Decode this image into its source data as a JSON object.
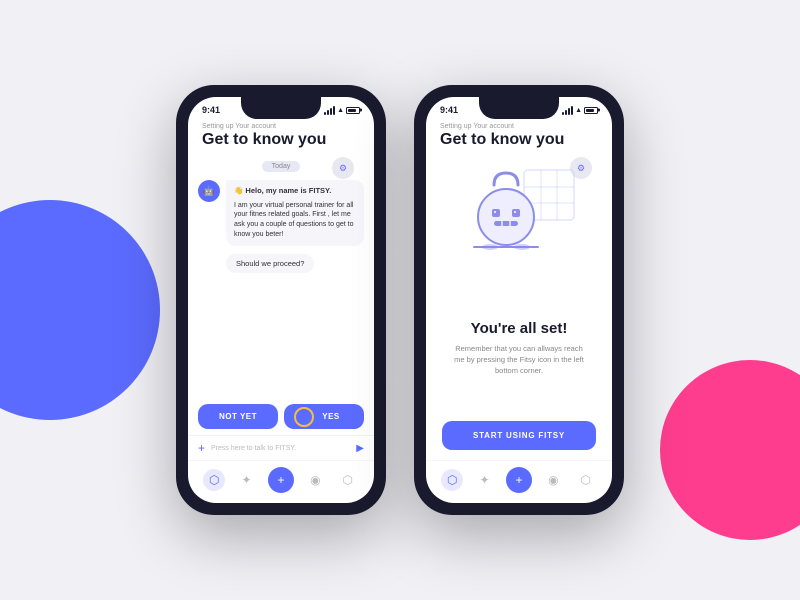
{
  "background": {
    "blob_blue_color": "#5b6bff",
    "blob_pink_color": "#ff3d8f"
  },
  "phone1": {
    "status_time": "9:41",
    "subtitle": "Setting up Your account",
    "title": "Get to know you",
    "date_badge": "Today",
    "greeting": "👋 Helo, my name is FITSY.",
    "message_body": "I am your virtual personal trainer for all your fitnes related goals. First , let me ask you a couple of questions to get to know you beter!",
    "proceed_text": "Should we proceed?",
    "btn_not_yet": "NOT YET",
    "btn_yes": "YES",
    "input_placeholder": "Press here to talk to FITSY.",
    "nav_items": [
      "dumbbell",
      "barbell",
      "plus",
      "bottle",
      "bag"
    ]
  },
  "phone2": {
    "status_time": "9:41",
    "subtitle": "Setting up Your account",
    "title": "Get to know you",
    "complete_title": "You're all set!",
    "complete_desc": "Remember that you can allways reach me by pressing the Fitsy icon in the left bottom corner.",
    "start_btn": "START USING FITSY",
    "nav_items": [
      "dumbbell",
      "barbell",
      "plus",
      "bottle",
      "bag"
    ]
  }
}
